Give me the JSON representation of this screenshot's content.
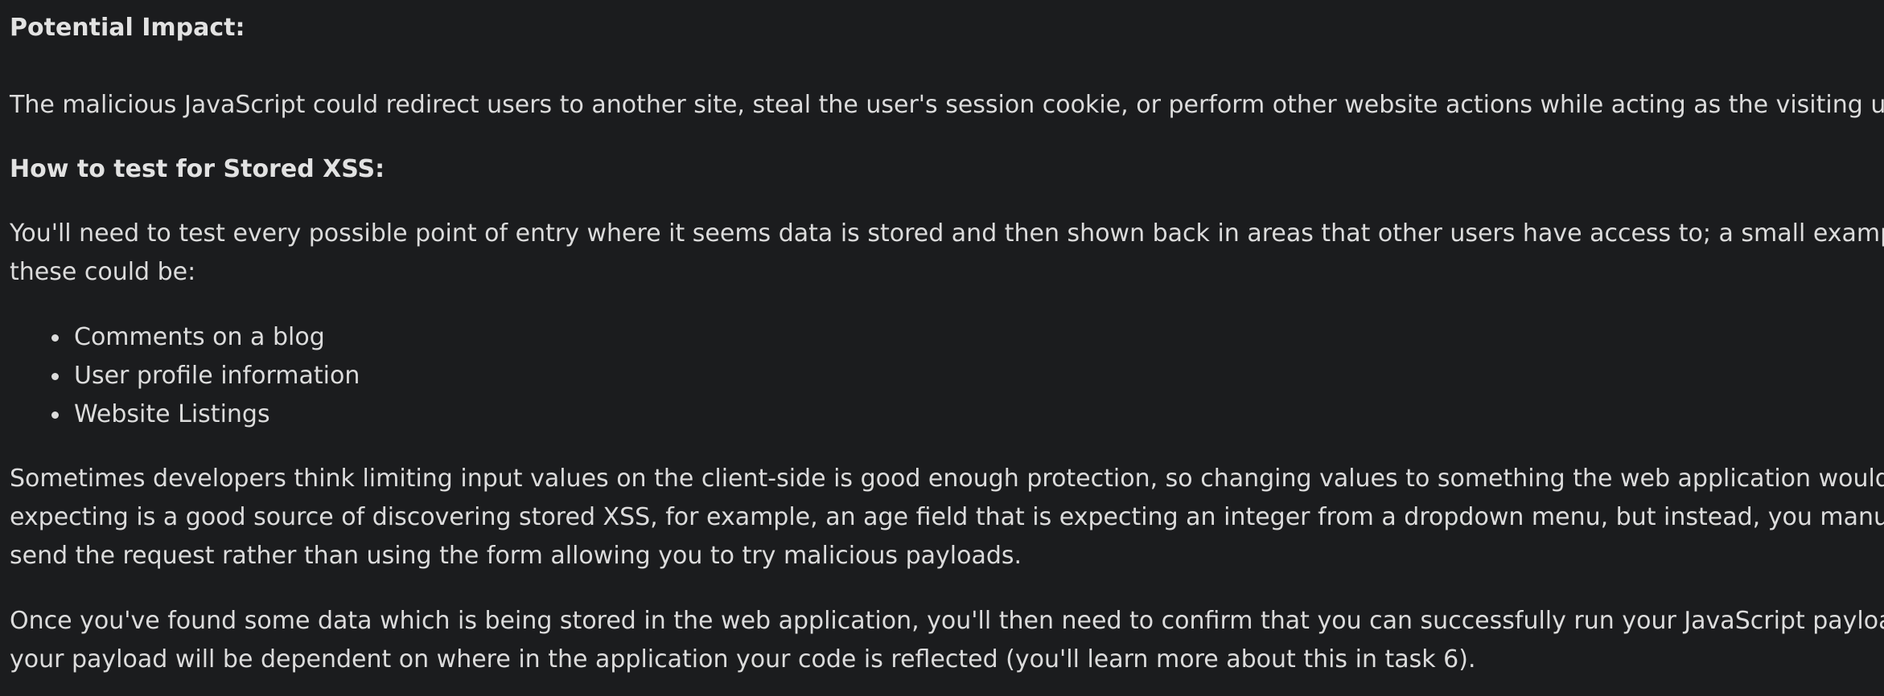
{
  "section_impact": {
    "heading": "Potential Impact:",
    "paragraph": "The malicious JavaScript could redirect users to another site, steal the user's session cookie, or perform other website actions while acting as the visiting user."
  },
  "section_test": {
    "heading": "How to test for Stored XSS:",
    "intro_lines": [
      "You'll need to test every possible point of entry where it seems data is stored and then shown back in areas that other users have access to; a small example of",
      "these could be:"
    ],
    "examples": [
      "Comments on a blog",
      "User profile information",
      "Website Listings"
    ],
    "client_side_lines": [
      "Sometimes developers think limiting input values on the client-side is good enough protection, so changing values to something the web application wouldn't be",
      "expecting is a good source of discovering stored XSS, for example, an age field that is expecting an integer from a dropdown menu, but instead, you manually",
      "send the request rather than using the form allowing you to try malicious payloads."
    ],
    "confirm_lines": [
      "Once you've found some data which is being stored in the web application,  you'll then need to confirm that you can successfully run your JavaScript payload;",
      "your payload will be dependent on where in the application your code is reflected (you'll learn more about this in task 6)."
    ]
  }
}
